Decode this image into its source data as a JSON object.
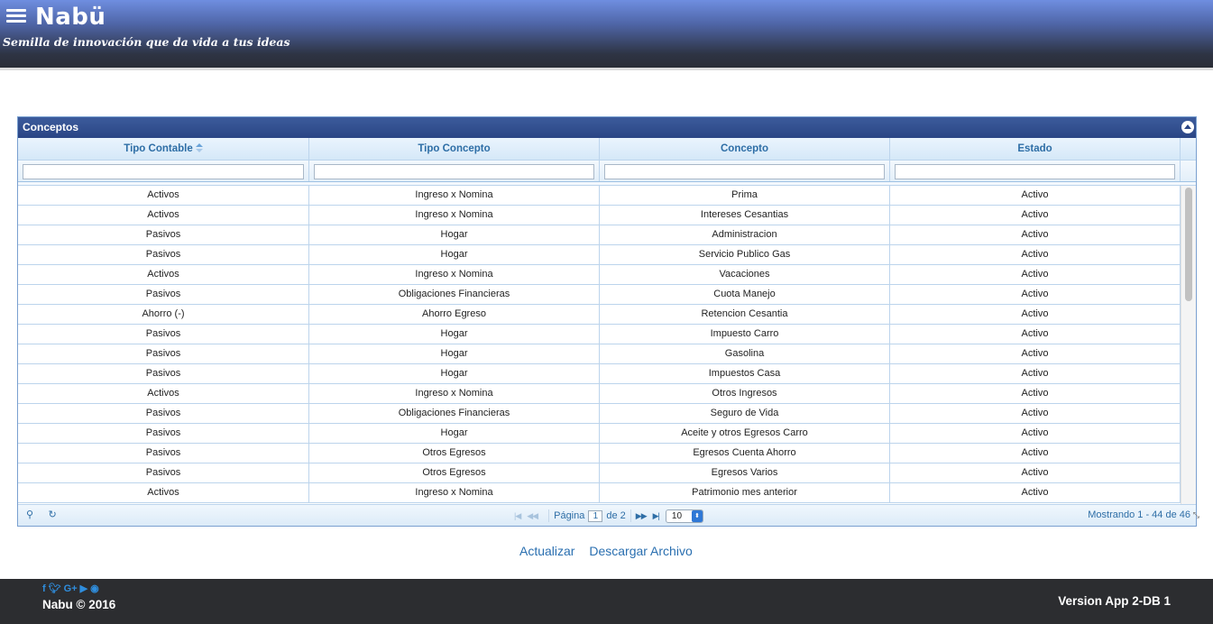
{
  "header": {
    "brand": "Nabü",
    "tagline": "Semilla de innovación que da vida a tus ideas",
    "menu_icon": "hamburger-menu-icon"
  },
  "grid": {
    "title": "Conceptos",
    "columns": [
      "Tipo Contable",
      "Tipo Concepto",
      "Concepto",
      "Estado"
    ],
    "sorted_column": "Tipo Contable",
    "filters": [
      "",
      "",
      "",
      ""
    ],
    "rows": [
      [
        "Activos",
        "Ingreso x Nomina",
        "Prima",
        "Activo"
      ],
      [
        "Activos",
        "Ingreso x Nomina",
        "Intereses Cesantias",
        "Activo"
      ],
      [
        "Pasivos",
        "Hogar",
        "Administracion",
        "Activo"
      ],
      [
        "Pasivos",
        "Hogar",
        "Servicio Publico Gas",
        "Activo"
      ],
      [
        "Activos",
        "Ingreso x Nomina",
        "Vacaciones",
        "Activo"
      ],
      [
        "Pasivos",
        "Obligaciones Financieras",
        "Cuota Manejo",
        "Activo"
      ],
      [
        "Ahorro (-)",
        "Ahorro Egreso",
        "Retencion Cesantia",
        "Activo"
      ],
      [
        "Pasivos",
        "Hogar",
        "Impuesto Carro",
        "Activo"
      ],
      [
        "Pasivos",
        "Hogar",
        "Gasolina",
        "Activo"
      ],
      [
        "Pasivos",
        "Hogar",
        "Impuestos Casa",
        "Activo"
      ],
      [
        "Activos",
        "Ingreso x Nomina",
        "Otros Ingresos",
        "Activo"
      ],
      [
        "Pasivos",
        "Obligaciones Financieras",
        "Seguro de Vida",
        "Activo"
      ],
      [
        "Pasivos",
        "Hogar",
        "Aceite y otros Egresos Carro",
        "Activo"
      ],
      [
        "Pasivos",
        "Otros Egresos",
        "Egresos Cuenta Ahorro",
        "Activo"
      ],
      [
        "Pasivos",
        "Otros Egresos",
        "Egresos Varios",
        "Activo"
      ],
      [
        "Activos",
        "Ingreso x Nomina",
        "Patrimonio mes anterior",
        "Activo"
      ]
    ],
    "pager": {
      "page_label": "Página",
      "current_page": "1",
      "of_label": "de 2",
      "rows_per_page": "10",
      "records_label": "Mostrando 1 - 44 de 46"
    }
  },
  "actions": {
    "refresh": "Actualizar",
    "download": "Descargar Archivo"
  },
  "footer": {
    "social_icons": [
      "f",
      "t",
      "G+",
      "yt",
      "gh"
    ],
    "copyright": "Nabu © 2016",
    "version": "Version App 2-DB 1"
  },
  "colors": {
    "header_top": "#6f8ee0",
    "header_bottom": "#2a2d36",
    "grid_title": "#2a4585",
    "link": "#2a6fb0",
    "footer": "#2c2d30"
  }
}
